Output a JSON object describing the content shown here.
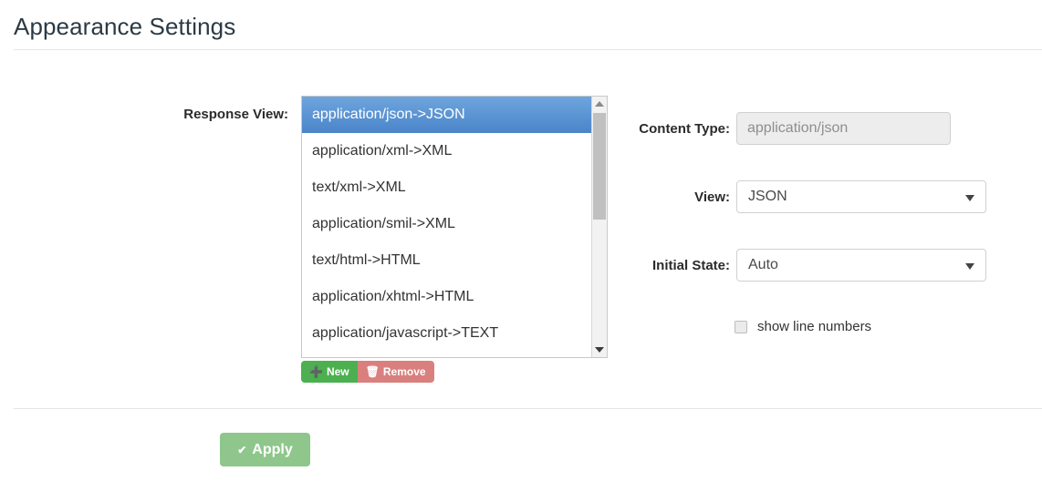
{
  "header": {
    "title": "Appearance Settings"
  },
  "response_view": {
    "label": "Response View:",
    "options": [
      "application/json->JSON",
      "application/xml->XML",
      "text/xml->XML",
      "application/smil->XML",
      "text/html->HTML",
      "application/xhtml->HTML",
      "application/javascript->TEXT"
    ],
    "selected_index": 0,
    "buttons": {
      "new_label": "New",
      "new_icon": "plus-circle-icon",
      "remove_label": "Remove",
      "remove_icon": "trash-icon"
    },
    "scrollbar": {
      "up_icon": "triangle-up-icon",
      "down_icon": "triangle-down-icon"
    }
  },
  "details": {
    "content_type": {
      "label": "Content Type:",
      "value": "application/json"
    },
    "view": {
      "label": "View:",
      "value": "JSON",
      "caret_icon": "chevron-down-icon"
    },
    "initial_state": {
      "label": "Initial State:",
      "value": "Auto",
      "caret_icon": "chevron-down-icon"
    },
    "show_line_numbers": {
      "label": "show line numbers",
      "checked": false
    }
  },
  "footer": {
    "apply_label": "Apply",
    "apply_icon": "check-icon"
  },
  "colors": {
    "selection_blue": "#5b92d4",
    "new_green": "#4cb050",
    "remove_red": "#d9807e",
    "apply_green": "#8ec68c"
  }
}
